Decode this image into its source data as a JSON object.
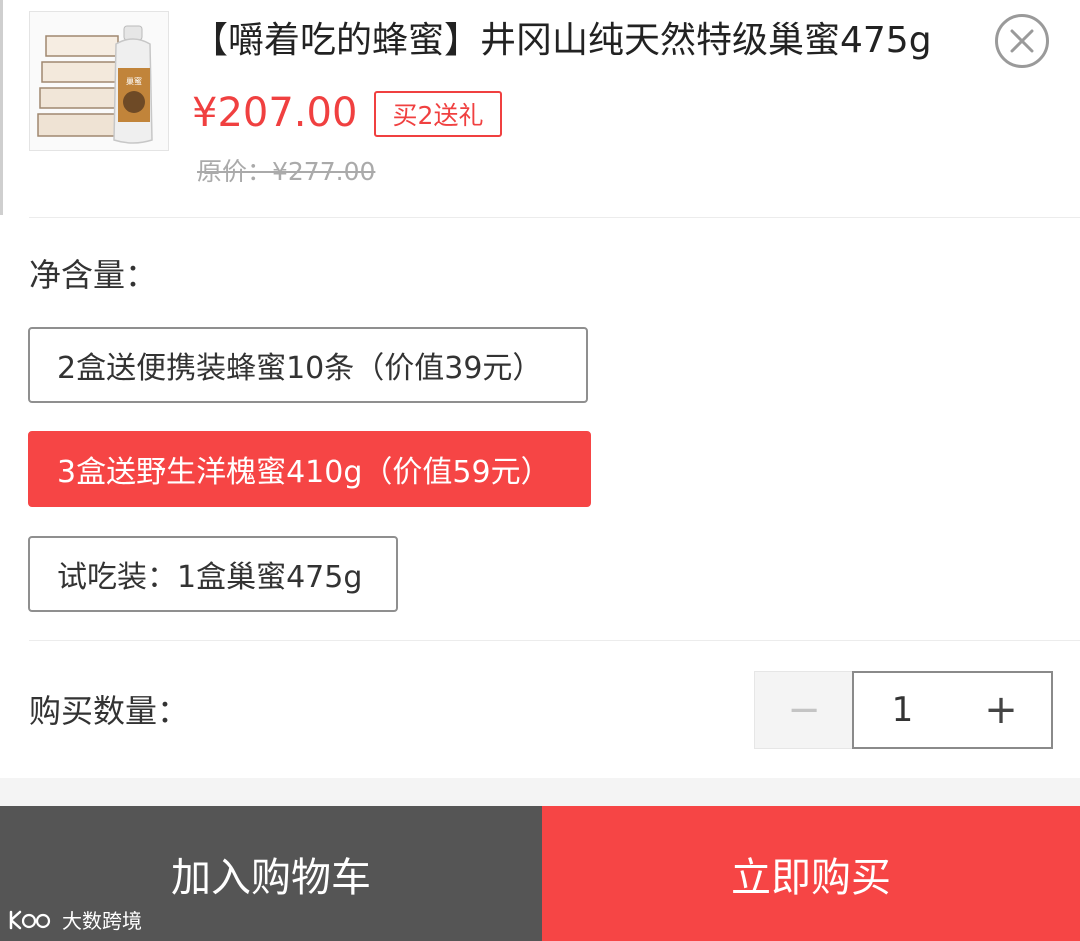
{
  "product": {
    "title": "【嚼着吃的蜂蜜】井冈山纯天然特级巢蜜475g",
    "price": "¥207.00",
    "badge": "买2送礼",
    "original_price": "原价：¥277.00",
    "thumb_label": "巢蜜"
  },
  "spec": {
    "label": "净含量：",
    "options": [
      {
        "label": "2盒送便携装蜂蜜10条（价值39元）",
        "selected": false
      },
      {
        "label": "3盒送野生洋槐蜜410g（价值59元）",
        "selected": true
      },
      {
        "label": "试吃装：1盒巢蜜475g",
        "selected": false
      }
    ]
  },
  "quantity": {
    "label": "购买数量：",
    "value": "1",
    "minus": "−",
    "plus": "+"
  },
  "actions": {
    "add_to_cart": "加入购物车",
    "buy_now": "立即购买"
  },
  "watermark": "大数跨境",
  "colors": {
    "accent": "#f64545",
    "price": "#f04040",
    "cart_button": "#555555"
  },
  "icons": {
    "close": "close-icon",
    "minus": "minus-icon",
    "plus": "plus-icon"
  }
}
